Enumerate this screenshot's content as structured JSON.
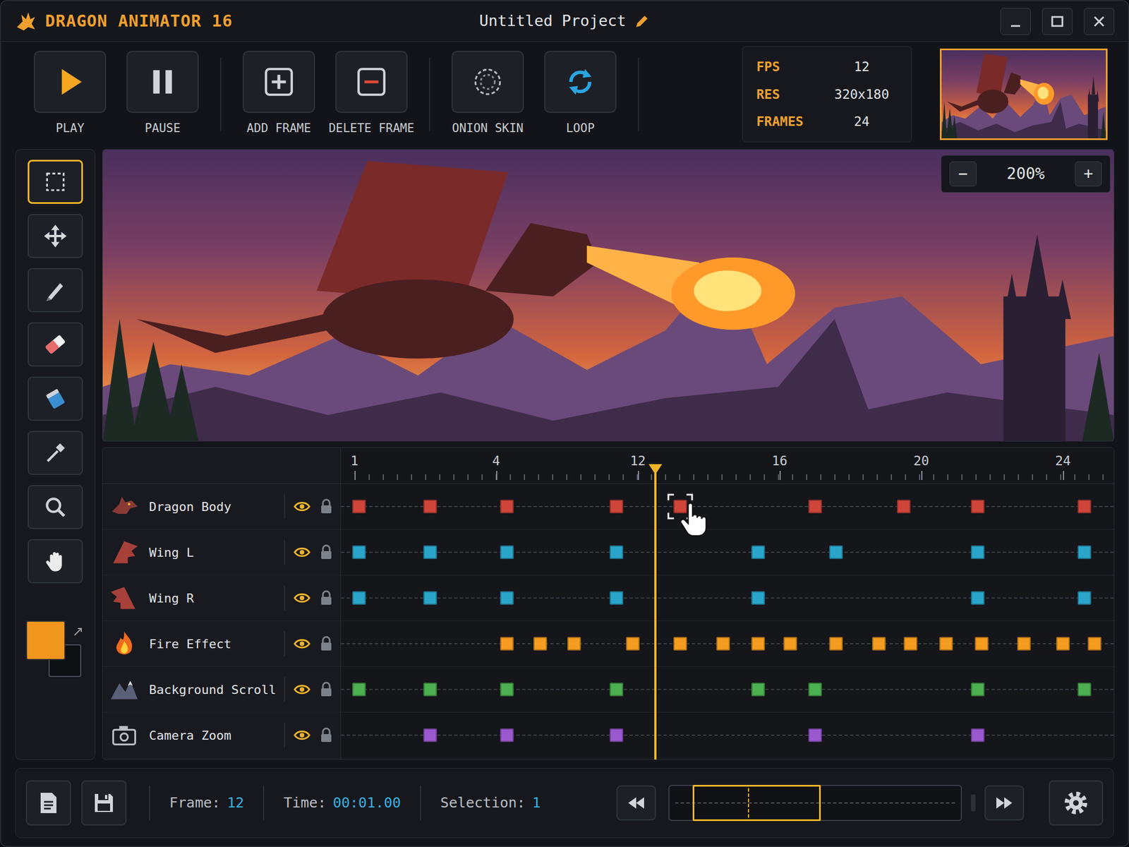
{
  "window": {
    "title": "DRAGON ANIMATOR 16",
    "project": "Untitled Project"
  },
  "toolbar": [
    {
      "label": "PLAY",
      "kind": "play",
      "on": false
    },
    {
      "label": "PAUSE",
      "kind": "pause",
      "on": false
    },
    {
      "label": "ADD FRAME",
      "kind": "add",
      "on": false
    },
    {
      "label": "DELETE FRAME",
      "kind": "delete",
      "on": false
    },
    {
      "label": "ONION SKIN",
      "kind": "onion",
      "on": false
    },
    {
      "label": "LOOP",
      "kind": "loop",
      "on": true
    }
  ],
  "info": [
    {
      "label": "FPS",
      "value": "12"
    },
    {
      "label": "RES",
      "value": "320x180"
    },
    {
      "label": "FRAMES",
      "value": "24"
    }
  ],
  "zoom": {
    "minus": "−",
    "value": "200%",
    "plus": "+"
  },
  "tools": [
    {
      "kind": "select",
      "selected": true
    },
    {
      "kind": "move",
      "selected": false
    },
    {
      "kind": "pencil",
      "selected": false
    },
    {
      "kind": "eraser",
      "selected": false
    },
    {
      "kind": "fill",
      "selected": false
    },
    {
      "kind": "eyedropper",
      "selected": false
    },
    {
      "kind": "zoom",
      "selected": false
    },
    {
      "kind": "hand",
      "selected": false
    }
  ],
  "colors": {
    "primary": "#f0961e",
    "secondary": "#0e0f12"
  },
  "timeline": {
    "ticks": [
      "1",
      "4",
      "12",
      "16",
      "20",
      "24"
    ],
    "playhead": 12.5,
    "layers": [
      {
        "name": "Dragon Body",
        "kind": "dragon",
        "visible": true,
        "locked": false,
        "color": "#d0453a",
        "keyframes": [
          {
            "frame": 1.1,
            "selected": false
          },
          {
            "frame": 2.6,
            "selected": false
          },
          {
            "frame": 4.6,
            "selected": false
          },
          {
            "frame": 10.8,
            "selected": false
          },
          {
            "frame": 13.2,
            "selected": true
          },
          {
            "frame": 17.0,
            "selected": false
          },
          {
            "frame": 19.5,
            "selected": false
          },
          {
            "frame": 21.6,
            "selected": false
          },
          {
            "frame": 24.6,
            "selected": false
          }
        ]
      },
      {
        "name": "Wing L",
        "kind": "wing-left",
        "visible": true,
        "locked": false,
        "color": "#2aa5c9",
        "keyframes": [
          {
            "frame": 1.1,
            "selected": false
          },
          {
            "frame": 2.6,
            "selected": false
          },
          {
            "frame": 4.6,
            "selected": false
          },
          {
            "frame": 10.8,
            "selected": false
          },
          {
            "frame": 15.4,
            "selected": false
          },
          {
            "frame": 17.6,
            "selected": false
          },
          {
            "frame": 21.6,
            "selected": false
          },
          {
            "frame": 24.6,
            "selected": false
          }
        ]
      },
      {
        "name": "Wing R",
        "kind": "wing-right",
        "visible": true,
        "locked": false,
        "color": "#2aa5c9",
        "keyframes": [
          {
            "frame": 1.1,
            "selected": false
          },
          {
            "frame": 2.6,
            "selected": false
          },
          {
            "frame": 4.6,
            "selected": false
          },
          {
            "frame": 10.8,
            "selected": false
          },
          {
            "frame": 15.4,
            "selected": false
          },
          {
            "frame": 21.6,
            "selected": false
          },
          {
            "frame": 24.6,
            "selected": false
          }
        ]
      },
      {
        "name": "Fire Effect",
        "kind": "fire",
        "visible": true,
        "locked": false,
        "color": "#f39c1f",
        "keyframes": [
          {
            "frame": 4.6,
            "selected": false
          },
          {
            "frame": 6.5,
            "selected": false
          },
          {
            "frame": 8.4,
            "selected": false
          },
          {
            "frame": 11.7,
            "selected": false
          },
          {
            "frame": 13.2,
            "selected": false
          },
          {
            "frame": 14.4,
            "selected": false
          },
          {
            "frame": 15.4,
            "selected": false
          },
          {
            "frame": 16.3,
            "selected": false
          },
          {
            "frame": 17.6,
            "selected": false
          },
          {
            "frame": 18.8,
            "selected": false
          },
          {
            "frame": 19.7,
            "selected": false
          },
          {
            "frame": 20.7,
            "selected": false
          },
          {
            "frame": 21.7,
            "selected": false
          },
          {
            "frame": 22.9,
            "selected": false
          },
          {
            "frame": 24.0,
            "selected": false
          },
          {
            "frame": 24.9,
            "selected": false
          }
        ]
      },
      {
        "name": "Background Scroll",
        "kind": "mountains",
        "visible": true,
        "locked": false,
        "color": "#4caf50",
        "keyframes": [
          {
            "frame": 1.1,
            "selected": false
          },
          {
            "frame": 2.6,
            "selected": false
          },
          {
            "frame": 4.6,
            "selected": false
          },
          {
            "frame": 10.8,
            "selected": false
          },
          {
            "frame": 15.4,
            "selected": false
          },
          {
            "frame": 17.0,
            "selected": false
          },
          {
            "frame": 21.6,
            "selected": false
          },
          {
            "frame": 24.6,
            "selected": false
          }
        ]
      },
      {
        "name": "Camera Zoom",
        "kind": "camera",
        "visible": true,
        "locked": false,
        "color": "#9b59d0",
        "keyframes": [
          {
            "frame": 2.6,
            "selected": false
          },
          {
            "frame": 4.6,
            "selected": false
          },
          {
            "frame": 10.8,
            "selected": false
          },
          {
            "frame": 17.0,
            "selected": false
          },
          {
            "frame": 21.6,
            "selected": false
          }
        ]
      }
    ]
  },
  "status": {
    "frame_label": "Frame:",
    "frame": "12",
    "time_label": "Time:",
    "time": "00:01.00",
    "selection_label": "Selection:",
    "selection": "1"
  },
  "scrubber": {
    "start": 0.08,
    "end": 0.52,
    "playhead": 0.27
  }
}
